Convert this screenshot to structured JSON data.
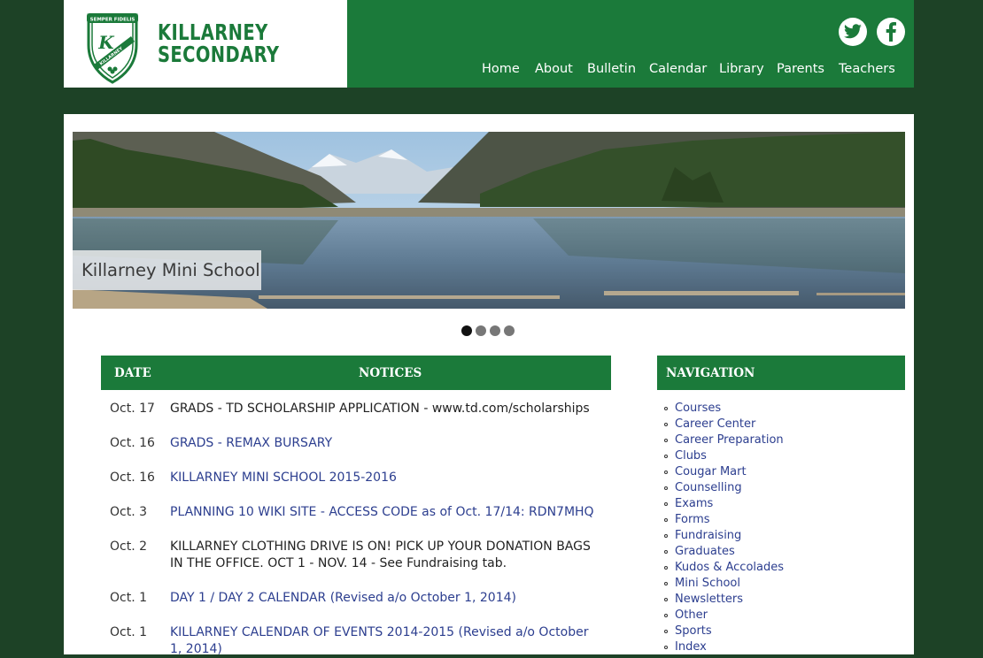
{
  "header": {
    "name_line1": "KILLARNEY",
    "name_line2": "SECONDARY",
    "crest": {
      "motto": "SEMPER FIDELIS",
      "banner": "KILLARNEY"
    },
    "social": [
      {
        "name": "twitter",
        "icon": "twitter-icon"
      },
      {
        "name": "facebook",
        "icon": "facebook-icon"
      }
    ],
    "nav": [
      "Home",
      "About",
      "Bulletin",
      "Calendar",
      "Library",
      "Parents",
      "Teachers"
    ]
  },
  "slider": {
    "caption": "Killarney Mini School",
    "slide_count": 4,
    "active_slide": 1
  },
  "notices": {
    "date_header": "DATE",
    "title_header": "NOTICES",
    "items": [
      {
        "date": "Oct. 17",
        "title": "GRADS - TD SCHOLARSHIP APPLICATION - www.td.com/scholarships",
        "link": false
      },
      {
        "date": "Oct. 16",
        "title": "GRADS - REMAX BURSARY",
        "link": true
      },
      {
        "date": "Oct. 16",
        "title": "KILLARNEY MINI SCHOOL 2015-2016",
        "link": true
      },
      {
        "date": "Oct. 3",
        "title": "PLANNING 10 WIKI SITE - ACCESS CODE as of Oct. 17/14: RDN7MHQ",
        "link": true
      },
      {
        "date": "Oct. 2",
        "title": "KILLARNEY CLOTHING DRIVE IS ON! PICK UP YOUR DONATION BAGS IN THE OFFICE. OCT 1 - NOV. 14 - See Fundraising tab.",
        "link": false
      },
      {
        "date": "Oct. 1",
        "title": "DAY 1 / DAY 2 CALENDAR (Revised a/o October 1, 2014)",
        "link": true
      },
      {
        "date": "Oct. 1",
        "title": "KILLARNEY CALENDAR OF EVENTS 2014-2015 (Revised a/o October 1, 2014)",
        "link": true
      }
    ]
  },
  "sidenav": {
    "heading": "NAVIGATION",
    "items": [
      "Courses",
      "Career Center",
      "Career Preparation",
      "Clubs",
      "Cougar Mart",
      "Counselling",
      "Exams",
      "Forms",
      "Fundraising",
      "Graduates",
      "Kudos & Accolades",
      "Mini School",
      "Newsletters",
      "Other",
      "Sports",
      "Index"
    ]
  },
  "colors": {
    "brand_green": "#1b7a3a",
    "page_background": "#1d4226",
    "link_blue": "#2c3e8f"
  }
}
